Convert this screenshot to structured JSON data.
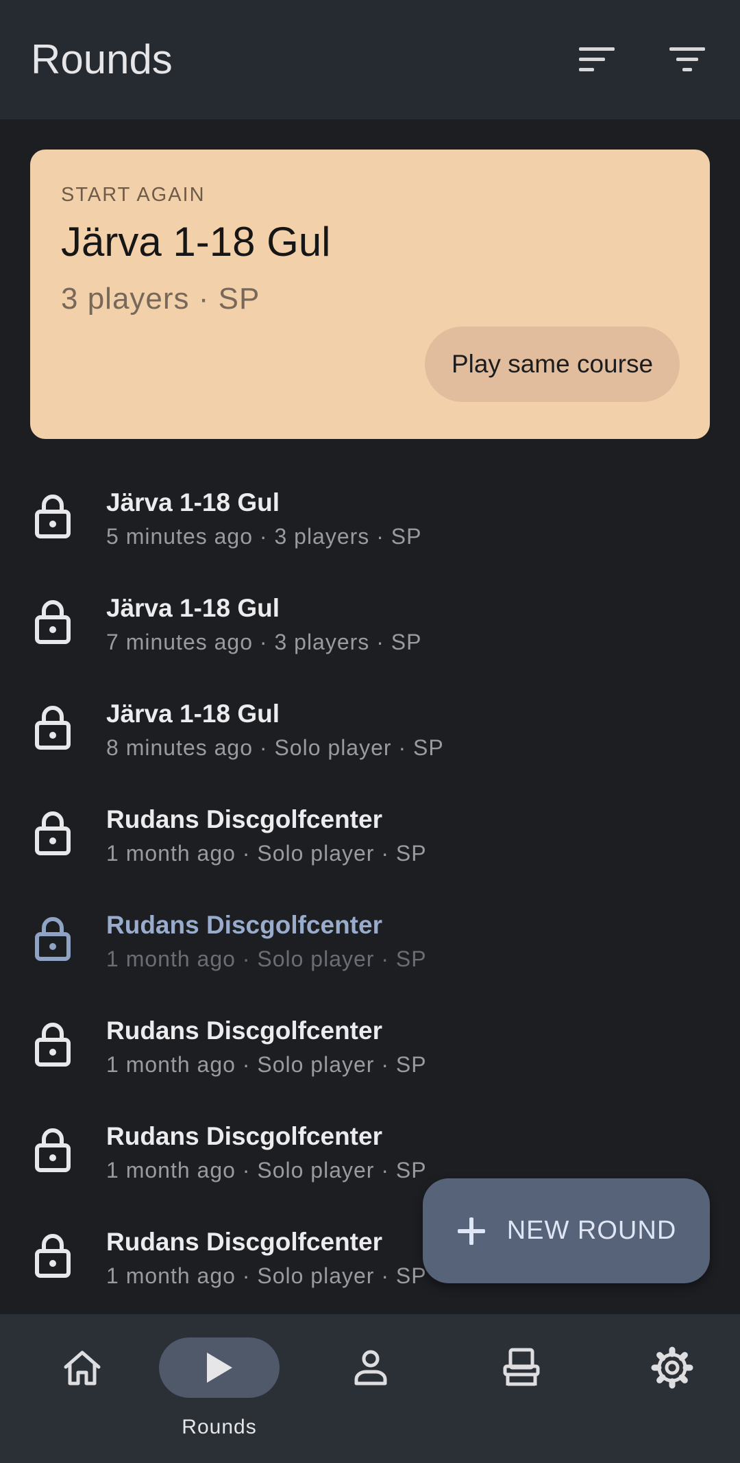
{
  "header": {
    "title": "Rounds",
    "sort_icon": "sort-icon",
    "filter_icon": "filter-icon"
  },
  "start_again_card": {
    "overline": "START AGAIN",
    "course": "Järva 1-18 Gul",
    "meta": "3 players · SP",
    "button_label": "Play same course"
  },
  "rounds": [
    {
      "name": "Järva 1-18 Gul",
      "sub": "5 minutes ago · 3 players · SP"
    },
    {
      "name": "Järva 1-18 Gul",
      "sub": "7 minutes ago · 3 players · SP"
    },
    {
      "name": "Järva 1-18 Gul",
      "sub": "8 minutes ago · Solo player · SP"
    },
    {
      "name": "Rudans Discgolfcenter",
      "sub": "1 month ago · Solo player · SP"
    },
    {
      "name": "Rudans Discgolfcenter",
      "sub": "1 month ago · Solo player · SP"
    },
    {
      "name": "Rudans Discgolfcenter",
      "sub": "1 month ago · Solo player · SP"
    },
    {
      "name": "Rudans Discgolfcenter",
      "sub": "1 month ago · Solo player · SP"
    },
    {
      "name": "Rudans Discgolfcenter",
      "sub": "1 month ago · Solo player · SP"
    }
  ],
  "fab": {
    "label": "NEW ROUND"
  },
  "nav": {
    "items": [
      {
        "icon": "home-icon",
        "label": ""
      },
      {
        "icon": "play-icon",
        "label": "Rounds"
      },
      {
        "icon": "profile-icon",
        "label": ""
      },
      {
        "icon": "basket-icon",
        "label": ""
      },
      {
        "icon": "gear-icon",
        "label": ""
      }
    ]
  },
  "colors": {
    "appbar": "#262a31",
    "background": "#1d1e22",
    "card": "#f2d0aa",
    "card_button": "#e1bd9e",
    "fab": "#566379",
    "navbar": "#2b2f36",
    "nav_active": "#4f596a"
  }
}
